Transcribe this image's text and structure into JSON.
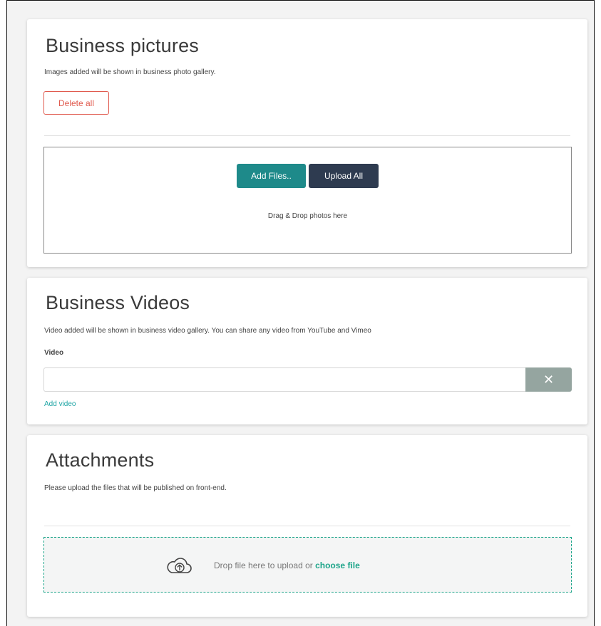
{
  "pictures": {
    "title": "Business pictures",
    "description": "Images added will be shown in business photo gallery.",
    "delete_all_label": "Delete all",
    "add_files_label": "Add Files..",
    "upload_all_label": "Upload All",
    "drop_hint": "Drag & Drop photos here"
  },
  "videos": {
    "title": "Business Videos",
    "description": "Video added will be shown in business video gallery. You can share any video from YouTube and Vimeo",
    "field_label": "Video",
    "field_value": "",
    "remove_label": "✕",
    "add_video_label": "Add video"
  },
  "attachments": {
    "title": "Attachments",
    "description": "Please upload the files that will be published on front-end.",
    "drop_text": "Drop file here to upload or",
    "choose_file_label": "choose file"
  },
  "colors": {
    "accent_teal": "#1e8a8a",
    "dark_navy": "#2e3b50",
    "danger_red": "#e05a4e",
    "link_teal": "#1ea5a5",
    "remove_grey": "#95a5a0"
  },
  "icons": {
    "remove": "close-icon",
    "upload": "cloud-upload-icon"
  }
}
